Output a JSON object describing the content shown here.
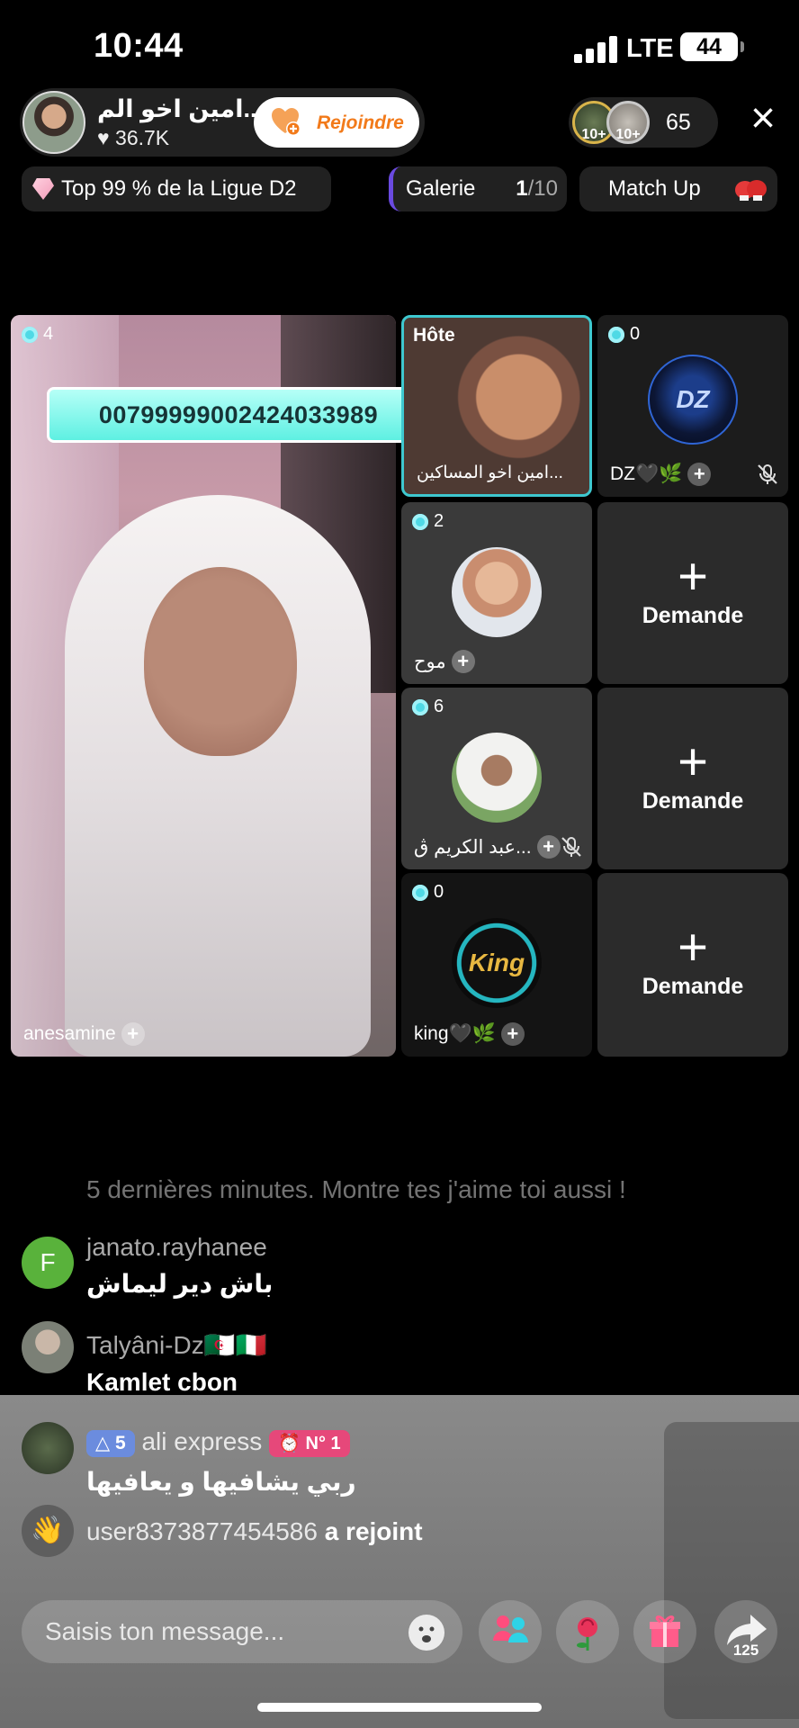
{
  "status_bar": {
    "time": "10:44",
    "network": "LTE",
    "battery": "44"
  },
  "host": {
    "name": "امين اخو الم...",
    "likes": "36.7K",
    "join_label": "Rejoindre"
  },
  "viewers": {
    "badge1": "10+",
    "badge2": "10+",
    "count": "65"
  },
  "pills": {
    "league": "Top 99 % de la Ligue D2",
    "gallery_label": "Galerie",
    "gallery_current": "1",
    "gallery_total": "/10",
    "matchup_label": "Match Up"
  },
  "grid": {
    "main": {
      "count": "4",
      "name": "anesamine",
      "id_banner": "00799999002424033989"
    },
    "host_tile": {
      "role": "Hôte",
      "name": "امين اخو المساكين..."
    },
    "dz": {
      "count": "0",
      "name": "DZ🖤🌿",
      "avatar_text": "DZ"
    },
    "moh": {
      "count": "2",
      "name": "موح"
    },
    "abd": {
      "count": "6",
      "name": "عبد الكريم ڨ..."
    },
    "king": {
      "count": "0",
      "name": "king🖤🌿",
      "avatar_text": "King"
    },
    "request_label": "Demande",
    "request_plus": "+"
  },
  "comments": {
    "system": "5 dernières minutes. Montre tes j'aime toi aussi !",
    "items": [
      {
        "user": "janato.rayhanee",
        "initial": "F",
        "text": "باش دير ليماش"
      },
      {
        "user": "Talyâni-Dz🇩🇿🇮🇹",
        "text": "Kamlet cbon"
      },
      {
        "user": "ali express",
        "level": "5",
        "rank": "N° 1",
        "text": "ربي يشافيها و يعافيها"
      }
    ],
    "joined_user": "user8373877454586",
    "joined_text": "a rejoint"
  },
  "input": {
    "placeholder": "Saisis ton message..."
  },
  "actions": {
    "share_count": "125"
  },
  "colors": {
    "accent_cyan": "#3ec8cf",
    "join_orange": "#f27a1a",
    "comment_green": "#59b23b"
  }
}
